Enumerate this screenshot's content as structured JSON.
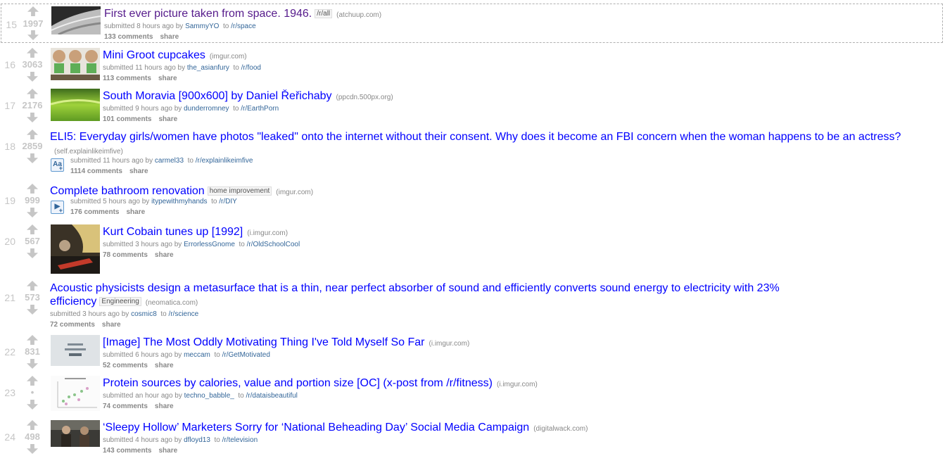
{
  "colors": {
    "link": "#0000ff",
    "visited": "#551a8b",
    "meta": "#888888",
    "user": "#336699",
    "arrow": "#c6c6c6"
  },
  "posts": [
    {
      "rank": "15",
      "score": "1997",
      "title": "First ever picture taken from space. 1946.",
      "flair": "/r/all",
      "domain": "(atchuup.com)",
      "time": "submitted 8 hours ago by",
      "user": "SammyYO",
      "to": "to",
      "sub": "/r/space",
      "comments": "133 comments",
      "share": "share",
      "thumb": "space-photo",
      "visited": true
    },
    {
      "rank": "16",
      "score": "3063",
      "title": "Mini Groot cupcakes",
      "flair": "",
      "domain": "(imgur.com)",
      "time": "submitted 11 hours ago by",
      "user": "the_asianfury",
      "to": "to",
      "sub": "/r/food",
      "comments": "113 comments",
      "share": "share",
      "thumb": "cupcakes"
    },
    {
      "rank": "17",
      "score": "2176",
      "title": "South Moravia [900x600] by Daniel Řeřichaby",
      "flair": "",
      "domain": "(ppcdn.500px.org)",
      "time": "submitted 9 hours ago by",
      "user": "dunderromney",
      "to": "to",
      "sub": "/r/EarthPorn",
      "comments": "101 comments",
      "share": "share",
      "thumb": "green-field"
    },
    {
      "rank": "18",
      "score": "2859",
      "title": "ELI5: Everyday girls/women have photos \"leaked\" onto the internet without their consent. Why does it become an FBI concern when the woman happens to be an actress?",
      "flair": "",
      "domain": "(self.explainlikeimfive)",
      "time": "submitted 11 hours ago by",
      "user": "carmel33",
      "to": "to",
      "sub": "/r/explainlikeimfive",
      "comments": "1114 comments",
      "share": "share",
      "thumb": "self-text"
    },
    {
      "rank": "19",
      "score": "999",
      "title": "Complete bathroom renovation",
      "flair": "home improvement",
      "domain": "(imgur.com)",
      "time": "submitted 5 hours ago by",
      "user": "itypewithmyhands",
      "to": "to",
      "sub": "/r/DIY",
      "comments": "176 comments",
      "share": "share",
      "thumb": "play"
    },
    {
      "rank": "20",
      "score": "567",
      "title": "Kurt Cobain tunes up [1992]",
      "flair": "",
      "domain": "(i.imgur.com)",
      "time": "submitted 3 hours ago by",
      "user": "ErrorlessGnome",
      "to": "to",
      "sub": "/r/OldSchoolCool",
      "comments": "78 comments",
      "share": "share",
      "thumb": "guitar"
    },
    {
      "rank": "21",
      "score": "573",
      "title": "Acoustic physicists design a metasurface that is a thin, near perfect absorber of sound and efficiently converts sound energy to electricity with 23% efficiency",
      "flair": "Engineering",
      "domain": "(neomatica.com)",
      "time": "submitted 3 hours ago by",
      "user": "cosmic8",
      "to": "to",
      "sub": "/r/science",
      "comments": "72 comments",
      "share": "share",
      "thumb": "none"
    },
    {
      "rank": "22",
      "score": "831",
      "title": "[Image] The Most Oddly Motivating Thing I've Told Myself So Far",
      "flair": "",
      "domain": "(i.imgur.com)",
      "time": "submitted 6 hours ago by",
      "user": "meccam",
      "to": "to",
      "sub": "/r/GetMotivated",
      "comments": "52 comments",
      "share": "share",
      "thumb": "motivation"
    },
    {
      "rank": "23",
      "score": "•",
      "title": "Protein sources by calories, value and portion size [OC] (x-post from /r/fitness)",
      "flair": "",
      "domain": "(i.imgur.com)",
      "time": "submitted an hour ago by",
      "user": "techno_babble_",
      "to": "to",
      "sub": "/r/dataisbeautiful",
      "comments": "74 comments",
      "share": "share",
      "thumb": "scatter"
    },
    {
      "rank": "24",
      "score": "498",
      "title": "‘Sleepy Hollow’ Marketers Sorry for ‘National Beheading Day’ Social Media Campaign",
      "flair": "",
      "domain": "(digitalwack.com)",
      "time": "submitted 4 hours ago by",
      "user": "dfloyd13",
      "to": "to",
      "sub": "/r/television",
      "comments": "143 comments",
      "share": "share",
      "thumb": "tv-still"
    }
  ]
}
